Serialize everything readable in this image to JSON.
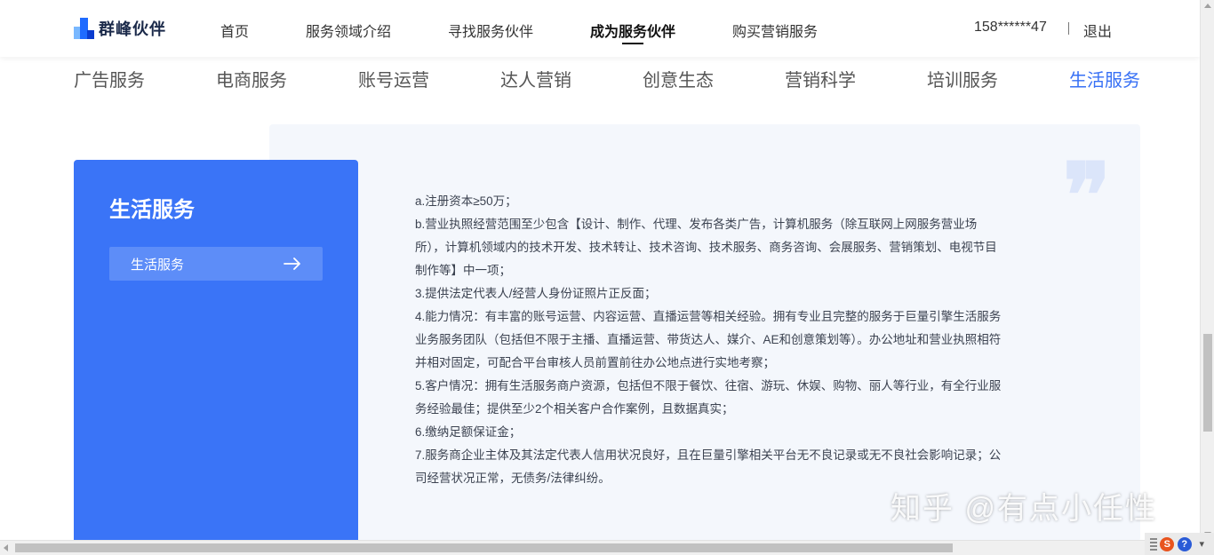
{
  "header": {
    "logo_text": "群峰伙伴",
    "nav": [
      {
        "label": "首页",
        "active": false
      },
      {
        "label": "服务领域介绍",
        "active": false
      },
      {
        "label": "寻找服务伙伴",
        "active": false
      },
      {
        "label": "成为服务伙伴",
        "active": true
      },
      {
        "label": "购买营销服务",
        "active": false
      }
    ],
    "user_phone": "158******47",
    "logout_label": "退出"
  },
  "categories": [
    {
      "label": "广告服务",
      "active": false
    },
    {
      "label": "电商服务",
      "active": false
    },
    {
      "label": "账号运营",
      "active": false
    },
    {
      "label": "达人营销",
      "active": false
    },
    {
      "label": "创意生态",
      "active": false
    },
    {
      "label": "营销科学",
      "active": false
    },
    {
      "label": "培训服务",
      "active": false
    },
    {
      "label": "生活服务",
      "active": true
    }
  ],
  "card": {
    "title": "生活服务",
    "button_label": "生活服务"
  },
  "requirements": {
    "lines": [
      "a.注册资本≥50万；",
      "b.营业执照经营范围至少包含【设计、制作、代理、发布各类广告，计算机服务（除互联网上网服务营业场",
      "所），计算机领域内的技术开发、技术转让、技术咨询、技术服务、商务咨询、会展服务、营销策划、电视节目",
      "制作等】中一项；",
      "3.提供法定代表人/经营人身份证照片正反面；",
      "4.能力情况：有丰富的账号运营、内容运营、直播运营等相关经验。拥有专业且完整的服务于巨量引擎生活服务",
      "业务服务团队（包括但不限于主播、直播运营、带货达人、媒介、AE和创意策划等）。办公地址和营业执照相符",
      "并相对固定，可配合平台审核人员前置前往办公地点进行实地考察；",
      "5.客户情况：拥有生活服务商户资源，包括但不限于餐饮、往宿、游玩、休娱、购物、丽人等行业，有全行业服",
      "务经验最佳；提供至少2个相关客户合作案例，且数据真实；",
      "6.缴纳足额保证金；",
      "7.服务商企业主体及其法定代表人信用状况良好，且在巨量引擎相关平台无不良记录或无不良社会影响记录；公",
      "司经营状况正常，无债务/法律纠纷。"
    ]
  },
  "watermark": "知乎 @有点小任性",
  "colors": {
    "accent": "#3770f5",
    "card_bg": "#3a74f7",
    "panel_bg": "#f4f7fc",
    "text": "#3c4351"
  },
  "icons": {
    "card_button": "arrow-right-icon",
    "quote": "quote-icon"
  }
}
